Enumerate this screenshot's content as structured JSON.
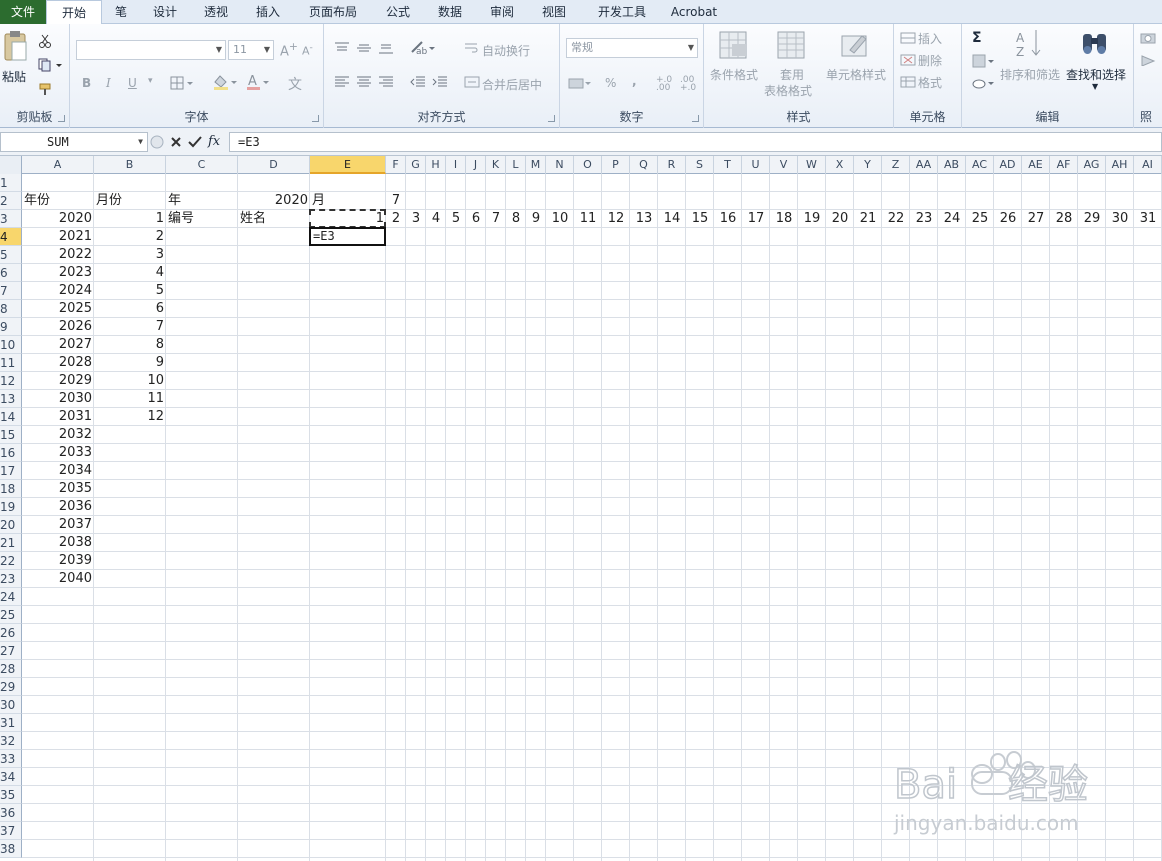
{
  "tabs": [
    "文件",
    "开始",
    "笔",
    "设计",
    "透视",
    "插入",
    "页面布局",
    "公式",
    "数据",
    "审阅",
    "视图",
    "开发工具",
    "Acrobat"
  ],
  "ribbon": {
    "clipboard": {
      "label": "剪贴板",
      "paste": "粘贴"
    },
    "font": {
      "label": "字体",
      "font_name": "",
      "font_size": "11",
      "bold": "B",
      "italic": "I",
      "underline": "U",
      "wen": "文"
    },
    "align": {
      "label": "对齐方式",
      "wrap": "自动换行",
      "merge": "合并后居中"
    },
    "number": {
      "label": "数字",
      "format": "常规",
      "percent": "%",
      "comma": ",",
      "inc": "+.0 .00",
      "dec": ".00 +.0"
    },
    "styles": {
      "label": "样式",
      "cond": "条件格式",
      "table1": "套用",
      "table2": "表格格式",
      "cell_styles": "单元格样式"
    },
    "cells": {
      "label": "单元格",
      "insert": "插入",
      "delete": "删除",
      "format": "格式"
    },
    "editing": {
      "label": "编辑",
      "sigma": "Σ",
      "sort": "排序和筛选",
      "find": "查找和选择"
    },
    "extra": {
      "label": "照"
    }
  },
  "formula_bar": {
    "name_box": "SUM",
    "fx": "fx",
    "formula": "=E3"
  },
  "columns": [
    "A",
    "B",
    "C",
    "D",
    "E",
    "F",
    "G",
    "H",
    "I",
    "J",
    "K",
    "L",
    "M",
    "N",
    "O",
    "P",
    "Q",
    "R",
    "S",
    "T",
    "U",
    "V",
    "W",
    "X",
    "Y",
    "Z",
    "AA",
    "AB",
    "AC",
    "AD",
    "AE",
    "AF",
    "AG",
    "AH",
    "AI"
  ],
  "selected_column": "E",
  "rows": [
    "1",
    "2",
    "3",
    "4",
    "5",
    "6",
    "7",
    "8",
    "9",
    "10",
    "11",
    "12",
    "13",
    "14",
    "15",
    "16",
    "17",
    "18",
    "19",
    "20",
    "21",
    "22",
    "23",
    "24",
    "25",
    "26",
    "27",
    "28",
    "29",
    "30",
    "31",
    "32",
    "33",
    "34",
    "35",
    "36",
    "37",
    "38"
  ],
  "selected_row": "4",
  "cells": {
    "A2": "年份",
    "B2": "月份",
    "C2": "年",
    "D2": "2020",
    "E2": "月",
    "F2": "7",
    "C3": "编号",
    "D3": "姓名",
    "E3": "1",
    "A3": "2020",
    "A4": "2021",
    "A5": "2022",
    "A6": "2023",
    "A7": "2024",
    "A8": "2025",
    "A9": "2026",
    "A10": "2027",
    "A11": "2028",
    "A12": "2029",
    "A13": "2030",
    "A14": "2031",
    "A15": "2032",
    "A16": "2033",
    "A17": "2034",
    "A18": "2035",
    "A19": "2036",
    "A20": "2037",
    "A21": "2038",
    "A22": "2039",
    "A23": "2040",
    "B3": "1",
    "B4": "2",
    "B5": "3",
    "B6": "4",
    "B7": "5",
    "B8": "6",
    "B9": "7",
    "B10": "8",
    "B11": "9",
    "B12": "10",
    "B13": "11",
    "B14": "12",
    "F3": "2",
    "G3": "3",
    "H3": "4",
    "I3": "5",
    "J3": "6",
    "K3": "7",
    "L3": "8",
    "M3": "9",
    "N3": "10",
    "O3": "11",
    "P3": "12",
    "Q3": "13",
    "R3": "14",
    "S3": "15",
    "T3": "16",
    "U3": "17",
    "V3": "18",
    "W3": "19",
    "X3": "20",
    "Y3": "21",
    "Z3": "22",
    "AA3": "23",
    "AB3": "24",
    "AC3": "25",
    "AD3": "26",
    "AE3": "27",
    "AF3": "28",
    "AG3": "29",
    "AH3": "30",
    "AI3": "31"
  },
  "active_cell": {
    "ref": "E4",
    "editing_text": "=E3"
  },
  "watermark": {
    "brand": "Baidu经验",
    "url": "jingyan.baidu.com"
  },
  "colors": {
    "file_tab": "#2c6c2f",
    "selection_header": "#f8d66c"
  }
}
